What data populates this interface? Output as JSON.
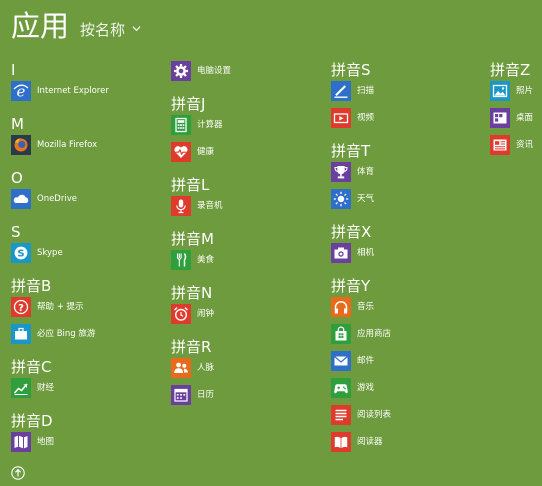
{
  "header": {
    "title": "应用",
    "sort_label": "按名称"
  },
  "icon_colors": {
    "blue": "#2d6fc9",
    "dark": "#2a3a4a",
    "cyan": "#1a97c9",
    "red": "#e03a2c",
    "purple": "#6b3fa0",
    "green": "#2f9e3d",
    "orange": "#e86a1a"
  },
  "columns": [
    {
      "groups": [
        {
          "heading": "I",
          "items": [
            {
              "label": "Internet Explorer",
              "icon": "internet-explorer-icon",
              "color": "blue"
            }
          ]
        },
        {
          "heading": "M",
          "items": [
            {
              "label": "Mozilla Firefox",
              "icon": "firefox-icon",
              "color": "dark"
            }
          ]
        },
        {
          "heading": "O",
          "items": [
            {
              "label": "OneDrive",
              "icon": "onedrive-icon",
              "color": "blue"
            }
          ]
        },
        {
          "heading": "S",
          "items": [
            {
              "label": "Skype",
              "icon": "skype-icon",
              "color": "cyan"
            }
          ]
        },
        {
          "heading": "拼音B",
          "items": [
            {
              "label": "帮助 + 提示",
              "icon": "help-icon",
              "color": "red"
            },
            {
              "label": "必应 Bing 旅游",
              "icon": "suitcase-icon",
              "color": "cyan"
            }
          ]
        },
        {
          "heading": "拼音C",
          "items": [
            {
              "label": "财经",
              "icon": "finance-chart-icon",
              "color": "green"
            }
          ]
        },
        {
          "heading": "拼音D",
          "items": [
            {
              "label": "地图",
              "icon": "map-icon",
              "color": "purple"
            }
          ]
        }
      ]
    },
    {
      "groups": [
        {
          "heading": "",
          "items": [
            {
              "label": "电脑设置",
              "icon": "gear-icon",
              "color": "purple"
            }
          ]
        },
        {
          "heading": "拼音J",
          "items": [
            {
              "label": "计算器",
              "icon": "calculator-icon",
              "color": "green"
            },
            {
              "label": "健康",
              "icon": "heart-pulse-icon",
              "color": "red"
            }
          ]
        },
        {
          "heading": "拼音L",
          "items": [
            {
              "label": "录音机",
              "icon": "microphone-icon",
              "color": "red"
            }
          ]
        },
        {
          "heading": "拼音M",
          "items": [
            {
              "label": "美食",
              "icon": "fork-knife-icon",
              "color": "green"
            }
          ]
        },
        {
          "heading": "拼音N",
          "items": [
            {
              "label": "闹钟",
              "icon": "alarm-clock-icon",
              "color": "red"
            }
          ]
        },
        {
          "heading": "拼音R",
          "items": [
            {
              "label": "人脉",
              "icon": "people-icon",
              "color": "orange"
            },
            {
              "label": "日历",
              "icon": "calendar-icon",
              "color": "purple"
            }
          ]
        }
      ]
    },
    {
      "groups": [
        {
          "heading": "拼音S",
          "items": [
            {
              "label": "扫描",
              "icon": "scanner-icon",
              "color": "blue"
            },
            {
              "label": "视频",
              "icon": "video-icon",
              "color": "red"
            }
          ]
        },
        {
          "heading": "拼音T",
          "items": [
            {
              "label": "体育",
              "icon": "trophy-icon",
              "color": "purple"
            },
            {
              "label": "天气",
              "icon": "sun-icon",
              "color": "blue"
            }
          ]
        },
        {
          "heading": "拼音X",
          "items": [
            {
              "label": "相机",
              "icon": "camera-icon",
              "color": "purple"
            }
          ]
        },
        {
          "heading": "拼音Y",
          "items": [
            {
              "label": "音乐",
              "icon": "headphones-icon",
              "color": "orange"
            },
            {
              "label": "应用商店",
              "icon": "store-bag-icon",
              "color": "green"
            },
            {
              "label": "邮件",
              "icon": "mail-icon",
              "color": "blue"
            },
            {
              "label": "游戏",
              "icon": "gamepad-icon",
              "color": "green"
            },
            {
              "label": "阅读列表",
              "icon": "reading-list-icon",
              "color": "red"
            },
            {
              "label": "阅读器",
              "icon": "book-icon",
              "color": "red"
            }
          ]
        }
      ]
    },
    {
      "groups": [
        {
          "heading": "拼音Z",
          "items": [
            {
              "label": "照片",
              "icon": "photos-icon",
              "color": "cyan"
            },
            {
              "label": "桌面",
              "icon": "desktop-icon",
              "color": "purple"
            },
            {
              "label": "资讯",
              "icon": "news-icon",
              "color": "red"
            }
          ]
        }
      ]
    }
  ]
}
